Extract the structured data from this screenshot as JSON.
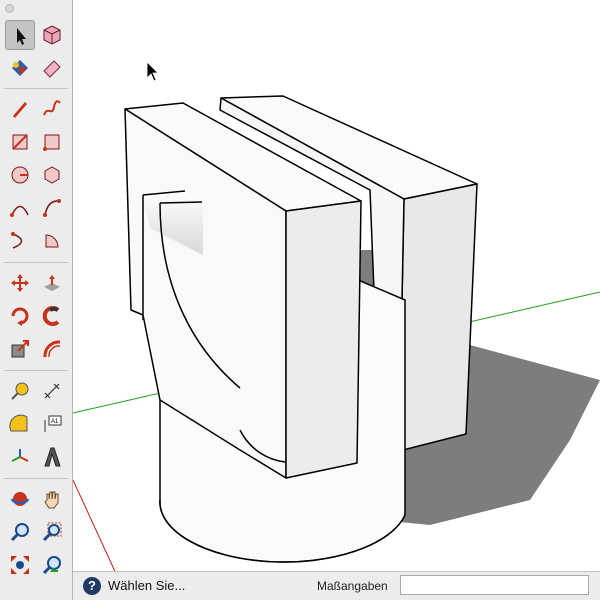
{
  "status": {
    "prompt": "Wählen Sie...",
    "help_icon": "?"
  },
  "measurements": {
    "label": "Maßangaben",
    "value": ""
  },
  "toolbar": {
    "tools": [
      "select-tool",
      "component-tool",
      "paint-bucket-tool",
      "eraser-tool",
      "line-tool",
      "freehand-tool",
      "rectangle-tool",
      "rotated-rectangle-tool",
      "circle-tool",
      "polygon-tool",
      "arc-tool",
      "two-point-arc-tool",
      "three-point-arc-tool",
      "pie-tool",
      "move-tool",
      "push-pull-tool",
      "rotate-tool",
      "follow-me-tool",
      "scale-tool",
      "offset-tool",
      "tape-measure-tool",
      "dimension-tool",
      "protractor-tool",
      "text-tool",
      "axes-tool",
      "3d-text-tool",
      "orbit-tool",
      "pan-tool",
      "zoom-tool",
      "zoom-window-tool",
      "zoom-extents-tool",
      "previous-view-tool"
    ],
    "active_tool": "select-tool"
  },
  "colors": {
    "green_axis": "#1aa31a",
    "red_axis": "#c21e1e",
    "shadow": "#7a7a7a",
    "toolbar_bg": "#ececec"
  }
}
